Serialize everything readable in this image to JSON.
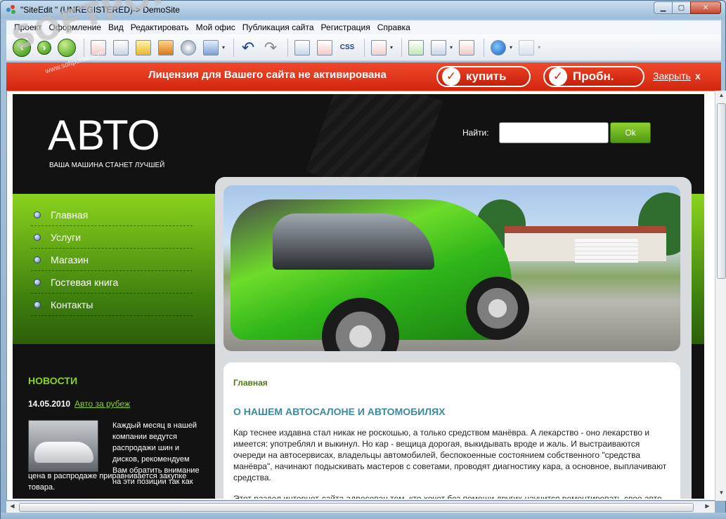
{
  "window": {
    "title": "\"SiteEdit \" (UNREGISTERED)-> DemoSite",
    "minimize_glyph": "▁",
    "maximize_glyph": "▢",
    "close_glyph": "✕"
  },
  "menu": [
    "Проект",
    "Оформление",
    "Вид",
    "Редактировать",
    "Мой офис",
    "Публикация сайта",
    "Регистрация",
    "Справка"
  ],
  "toolbar": {
    "back_glyph": "‹",
    "forward_glyph": "›",
    "css_label": "CSS",
    "undo_glyph": "↶",
    "redo_glyph": "↷",
    "dropdown_glyph": "▾"
  },
  "watermark": {
    "main": "SOFTPORTAL",
    "sub": "www.softportal.com"
  },
  "license": {
    "message": "Лицензия для Вашего сайта не активирована",
    "buy_label": "купить",
    "trial_label": "Пробн.",
    "close_label": "Закрыть",
    "close_x": "x",
    "check_glyph": "✓",
    "bar_color": "#d92a12"
  },
  "site": {
    "logo": "АВТО",
    "slogan": "ВАША МАШИНА СТАНЕТ ЛУЧШЕЙ",
    "search_label": "Найти:",
    "search_value": "",
    "search_button": "Ok",
    "nav": [
      "Главная",
      "Услуги",
      "Магазин",
      "Гостевая книга",
      "Контакты"
    ],
    "breadcrumb": "Главная",
    "content_title": "О НАШЕМ АВТОСАЛОНЕ И АВТОМОБИЛЯХ",
    "content_p1": "Кар теснее издавна стал никак не роскошью, а только средством манёвра. А лекарство - оно лекарство и имеется: употреблял и выкинул. Но кар - вещица дорогая, выкидывать вроде и жаль. И выстраиваются очереди на автосервисах, владельцы автомобилей, беспокоенные состоянием собственного \"средства манёвра\", начинают подыскивать мастеров с советами, проводят диагностику кара, а основное, выплачивают средства.",
    "content_p2": "Этот раздел интернет-сайта адресован тем, кто хочет без помощи других научится ремонтировать свое авто.",
    "news": {
      "title": "НОВОСТИ",
      "date": "14.05.2010",
      "link": "Авто за рубеж",
      "text_right": "Каждый месяц в нашей компании ведутся распродажи шин и дисков, рекомендуем Вам обратить внимание на эти позиции так как",
      "text_bottom": "цена в распродаже приравнивается закупке товара."
    },
    "accent_green": "#8bd31e",
    "link_blue": "#3b8a9f"
  },
  "scroll": {
    "up": "▲",
    "down": "▼",
    "left": "◀",
    "right": "▶"
  }
}
